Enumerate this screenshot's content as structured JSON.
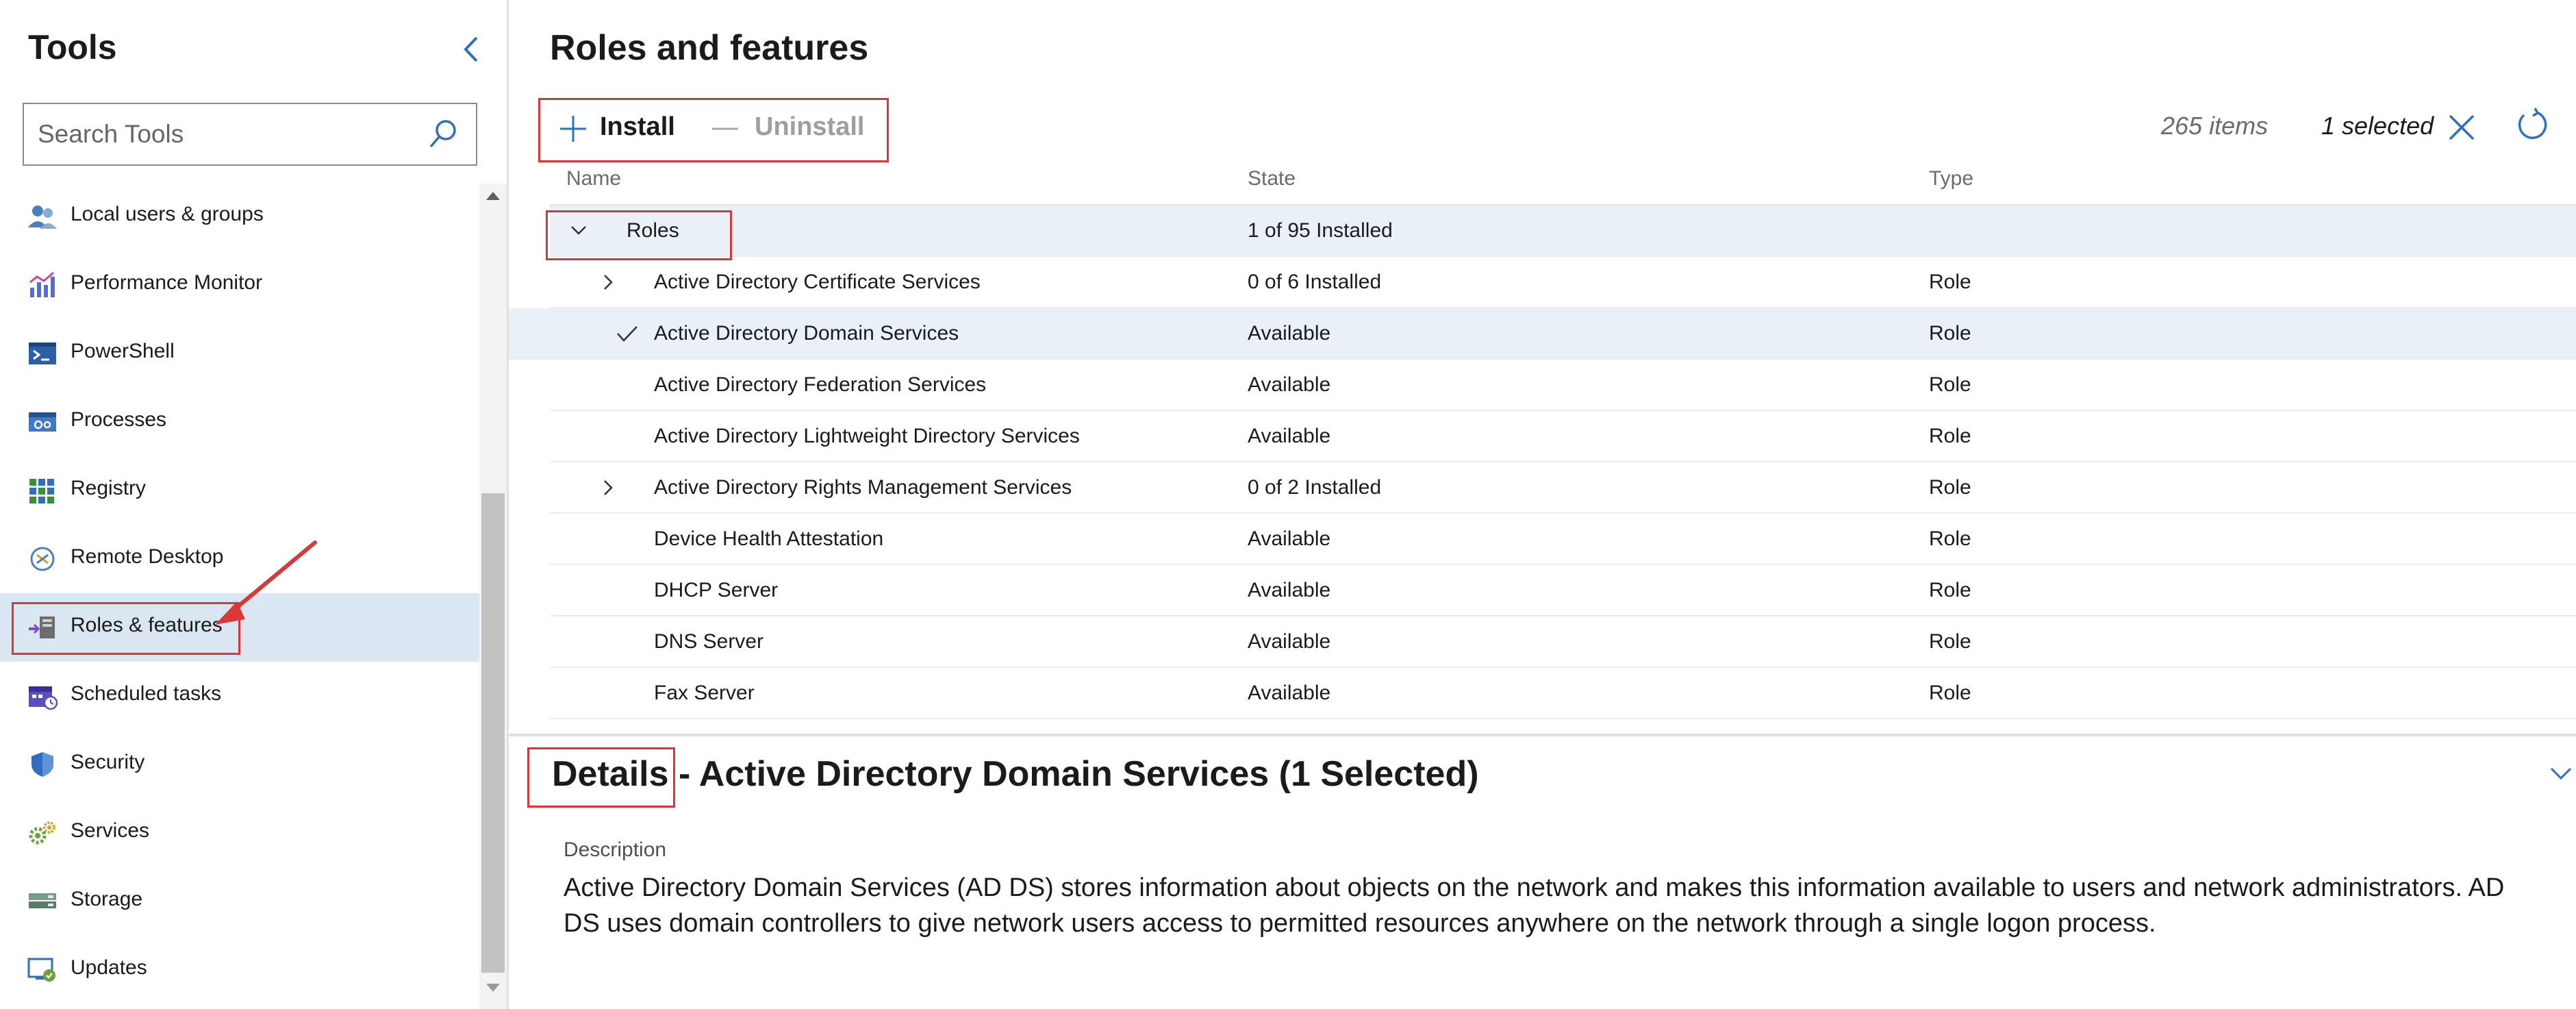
{
  "sidebar": {
    "title": "Tools",
    "search_placeholder": "Search Tools",
    "items": [
      {
        "label": "Local users & groups",
        "icon": "users-icon"
      },
      {
        "label": "Performance Monitor",
        "icon": "chart-icon"
      },
      {
        "label": "PowerShell",
        "icon": "powershell-icon"
      },
      {
        "label": "Processes",
        "icon": "processes-icon"
      },
      {
        "label": "Registry",
        "icon": "registry-icon"
      },
      {
        "label": "Remote Desktop",
        "icon": "remote-desktop-icon"
      },
      {
        "label": "Roles & features",
        "icon": "roles-features-icon",
        "selected": true
      },
      {
        "label": "Scheduled tasks",
        "icon": "calendar-icon"
      },
      {
        "label": "Security",
        "icon": "shield-icon"
      },
      {
        "label": "Services",
        "icon": "gears-icon"
      },
      {
        "label": "Storage",
        "icon": "storage-icon"
      },
      {
        "label": "Updates",
        "icon": "updates-icon"
      }
    ]
  },
  "main": {
    "title": "Roles and features",
    "toolbar": {
      "install_label": "Install",
      "uninstall_label": "Uninstall",
      "items_count": "265 items",
      "selected_count": "1 selected"
    },
    "columns": {
      "name": "Name",
      "state": "State",
      "type": "Type"
    },
    "rows": [
      {
        "name": "Roles",
        "state": "1 of 95 Installed",
        "type": "",
        "kind": "group",
        "expanded": true
      },
      {
        "name": "Active Directory Certificate Services",
        "state": "0 of 6 Installed",
        "type": "Role",
        "expandable": true
      },
      {
        "name": "Active Directory Domain Services",
        "state": "Available",
        "type": "Role",
        "selected": true
      },
      {
        "name": "Active Directory Federation Services",
        "state": "Available",
        "type": "Role"
      },
      {
        "name": "Active Directory Lightweight Directory Services",
        "state": "Available",
        "type": "Role"
      },
      {
        "name": "Active Directory Rights Management Services",
        "state": "0 of 2 Installed",
        "type": "Role",
        "expandable": true
      },
      {
        "name": "Device Health Attestation",
        "state": "Available",
        "type": "Role"
      },
      {
        "name": "DHCP Server",
        "state": "Available",
        "type": "Role"
      },
      {
        "name": "DNS Server",
        "state": "Available",
        "type": "Role"
      },
      {
        "name": "Fax Server",
        "state": "Available",
        "type": "Role"
      }
    ]
  },
  "details": {
    "title": "Details - Active Directory Domain Services (1 Selected)",
    "description_label": "Description",
    "description": "Active Directory Domain Services (AD DS) stores information about objects on the network and makes this information available to users and network administrators. AD DS uses domain controllers to give network users access to permitted resources anywhere on the network through a single logon process."
  },
  "colors": {
    "accent": "#2f6fbf",
    "selection": "#dbe6f3",
    "annotation": "#d93838"
  }
}
